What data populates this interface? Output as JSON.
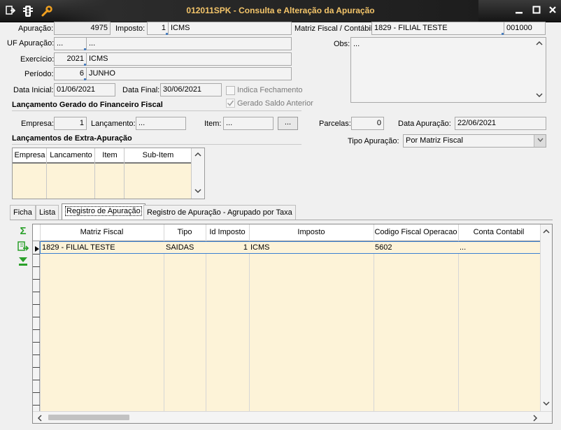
{
  "window": {
    "title": "012011SPK - Consulta e Alteração da Apuração",
    "colors": {
      "title_text": "#f4c56a",
      "grid_bg": "#fdf3d8",
      "selection_border": "#3a7fd2"
    }
  },
  "form": {
    "apuracao_label": "Apuração:",
    "apuracao_value": "4975",
    "imposto_label": "Imposto:",
    "imposto_id": "1",
    "imposto_name": "ICMS",
    "matriz_label": "Matriz Fiscal / Contábil:",
    "matriz_value": "1829 - FILIAL TESTE",
    "matriz_code": "001000",
    "uf_label": "UF Apuração:",
    "uf_value": "...",
    "uf_desc": "...",
    "obs_label": "Obs:",
    "obs_value": "...",
    "exercicio_label": "Exercício:",
    "exercicio_value": "2021",
    "exercicio_desc": "ICMS",
    "periodo_label": "Período:",
    "periodo_value": "6",
    "periodo_desc": "JUNHO",
    "data_inicial_label": "Data Inicial:",
    "data_inicial_value": "01/06/2021",
    "data_final_label": "Data Final:",
    "data_final_value": "30/06/2021",
    "indica_fechamento_label": "Indica Fechamento",
    "gerado_saldo_label": "Gerado Saldo Anterior"
  },
  "lancamento": {
    "section_title": "Lançamento Gerado do Financeiro Fiscal",
    "empresa_label": "Empresa:",
    "empresa_value": "1",
    "lancamento_label": "Lançamento:",
    "lancamento_value": "...",
    "item_label": "Item:",
    "item_value": "...",
    "item_button": "...",
    "parcelas_label": "Parcelas:",
    "parcelas_value": "0",
    "data_apuracao_label": "Data Apuração:",
    "data_apuracao_value": "22/06/2021",
    "tipo_apuracao_label": "Tipo Apuração:",
    "tipo_apuracao_value": "Por Matriz Fiscal"
  },
  "extra": {
    "section_title": "Lançamentos de Extra-Apuração",
    "columns": [
      "Empresa",
      "Lancamento",
      "Item",
      "Sub-Item"
    ]
  },
  "tabs": [
    "Ficha",
    "Lista",
    "Registro de Apuração",
    "Registro de Apuração - Agrupado por Taxa"
  ],
  "grid": {
    "columns": [
      "Matriz Fiscal",
      "Tipo",
      "Id Imposto",
      "Imposto",
      "Codigo Fiscal Operacao",
      "Conta Contabil"
    ],
    "rows": [
      {
        "matriz": "1829 - FILIAL TESTE",
        "tipo": "SAIDAS",
        "id_imposto": "1",
        "imposto": "ICMS",
        "codigo": "5602",
        "conta": "..."
      }
    ]
  },
  "icons": {
    "titlebar": [
      "menu-icon",
      "traffic-light-icon",
      "wrench-icon"
    ],
    "side_tools": [
      "sum-icon",
      "export-icon",
      "expand-down-icon"
    ]
  }
}
